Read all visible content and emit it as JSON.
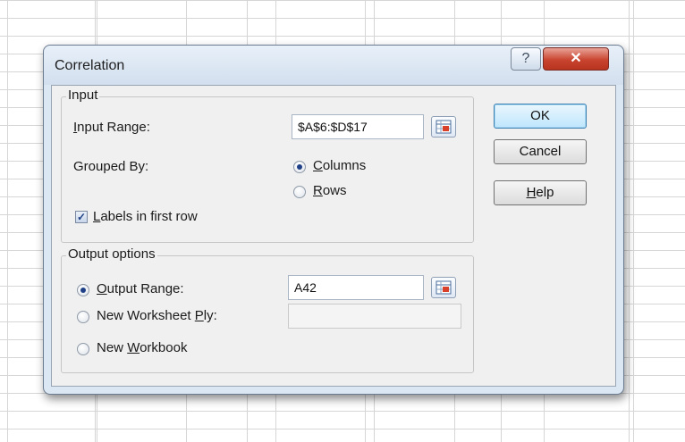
{
  "window": {
    "title": "Correlation",
    "help_button_label": "?",
    "close_button_label": "✕"
  },
  "input_group": {
    "legend": "Input",
    "input_range_label": "Input Range:",
    "input_range_value": "$A$6:$D$17",
    "grouped_by_label": "Grouped By:",
    "grouped_by_options": [
      {
        "label": "Columns",
        "selected": true
      },
      {
        "label": "Rows",
        "selected": false
      }
    ],
    "labels_in_first_row_label": "Labels in first row",
    "labels_in_first_row_checked": true
  },
  "output_group": {
    "legend": "Output options",
    "options": [
      {
        "label": "Output Range:",
        "selected": true,
        "value": "A42"
      },
      {
        "label": "New Worksheet Ply:",
        "selected": false,
        "value": ""
      },
      {
        "label": "New Workbook",
        "selected": false
      }
    ]
  },
  "buttons": {
    "ok": "OK",
    "cancel": "Cancel",
    "help": "Help"
  },
  "icons": {
    "help": "question-icon",
    "close": "close-icon",
    "collapse_dialog": "range-selector-icon"
  },
  "colors": {
    "dialog_frame": "#dce7f4",
    "close_button": "#c9442f",
    "ok_button": "#bee6fd",
    "client_area": "#f0f0f0"
  }
}
